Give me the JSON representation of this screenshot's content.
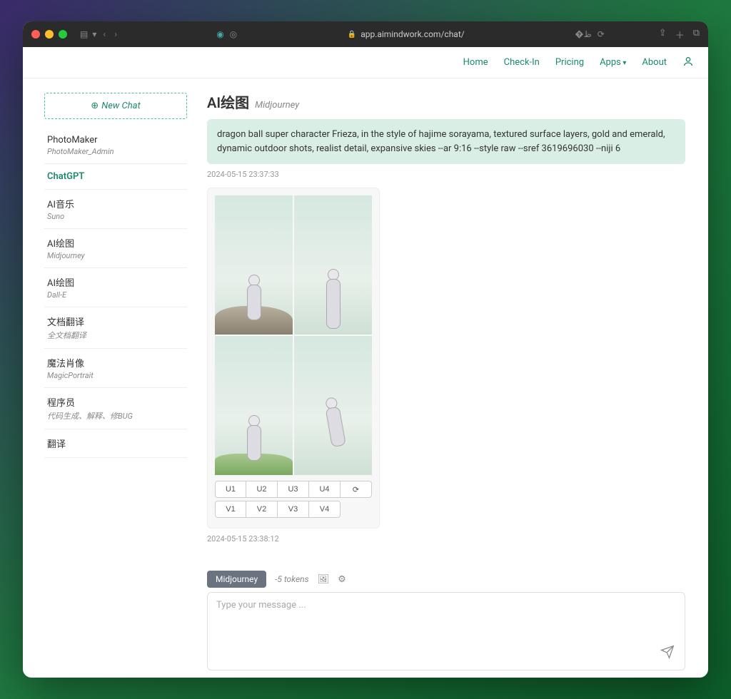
{
  "browser": {
    "url": "app.aimindwork.com/chat/"
  },
  "nav": {
    "home": "Home",
    "checkin": "Check-In",
    "pricing": "Pricing",
    "apps": "Apps",
    "about": "About"
  },
  "sidebar": {
    "new_chat": "New Chat",
    "items": [
      {
        "title": "PhotoMaker",
        "subtitle": "PhotoMaker_Admin"
      },
      {
        "title": "ChatGPT",
        "subtitle": ""
      },
      {
        "title": "AI音乐",
        "subtitle": "Suno"
      },
      {
        "title": "AI绘图",
        "subtitle": "Midjourney"
      },
      {
        "title": "AI绘图",
        "subtitle": "Dall-E"
      },
      {
        "title": "文档翻译",
        "subtitle": "全文档翻译"
      },
      {
        "title": "魔法肖像",
        "subtitle": "MagicPortrait"
      },
      {
        "title": "程序员",
        "subtitle": "代码生成、解释、修BUG"
      },
      {
        "title": "翻译",
        "subtitle": ""
      }
    ]
  },
  "page": {
    "title": "AI绘图",
    "subtitle": "Midjourney"
  },
  "messages": {
    "prompt": "dragon ball super character Frieza, in the style of hajime sorayama, textured surface layers, gold and emerald, dynamic outdoor shots, realist detail, expansive skies --ar 9:16 --style raw --sref 3619696030 --niji 6",
    "prompt_ts": "2024-05-15 23:37:33",
    "reply_ts": "2024-05-15 23:38:12",
    "buttons_u": [
      "U1",
      "U2",
      "U3",
      "U4"
    ],
    "buttons_v": [
      "V1",
      "V2",
      "V3",
      "V4"
    ],
    "refresh": "⟳"
  },
  "composer": {
    "model": "Midjourney",
    "tokens": "-5 tokens",
    "placeholder": "Type your message ..."
  }
}
